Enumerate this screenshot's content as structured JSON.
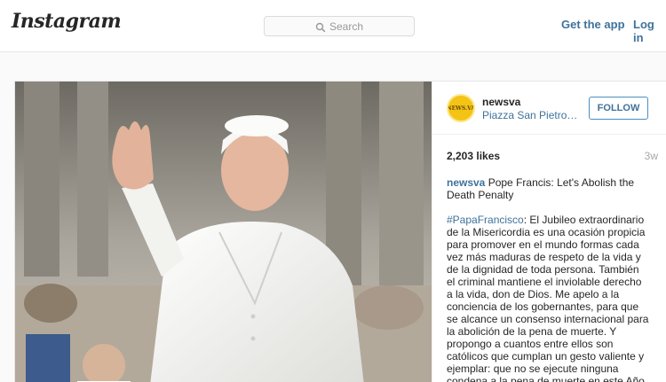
{
  "nav": {
    "logo": "Instagram",
    "search_placeholder": "Search",
    "get_app": "Get the app",
    "login": "Log in"
  },
  "post": {
    "username": "newsva",
    "location": "Piazza San Pietro, Vaticano",
    "follow_label": "FOLLOW",
    "likes": "2,203 likes",
    "age": "3w",
    "caption_user": "newsva",
    "caption_title": "Pope Francis: Let's Abolish the Death Penalty",
    "hashtag": "#PapaFrancisco",
    "body": ": El Jubileo extraordinario de la Misericordia es una ocasión propicia para promover en el mundo formas cada vez más maduras de respeto de la vida y de la dignidad de toda persona. También el criminal mantiene el inviolable derecho a la vida, don de Dios. Me apelo a la conciencia de los gobernantes, para que se alcance un consenso internacional para la abolición de la pena de muerte. Y propongo a cuantos entre ellos son católicos que cumplan un gesto valiente y ejemplar: que no se ejecute ninguna condena a la pena de muerte en este Año Santo de la Misericordia."
  },
  "colors": {
    "link": "#3f729b",
    "border": "#e6e6e6",
    "avatar": "#f3c316"
  }
}
